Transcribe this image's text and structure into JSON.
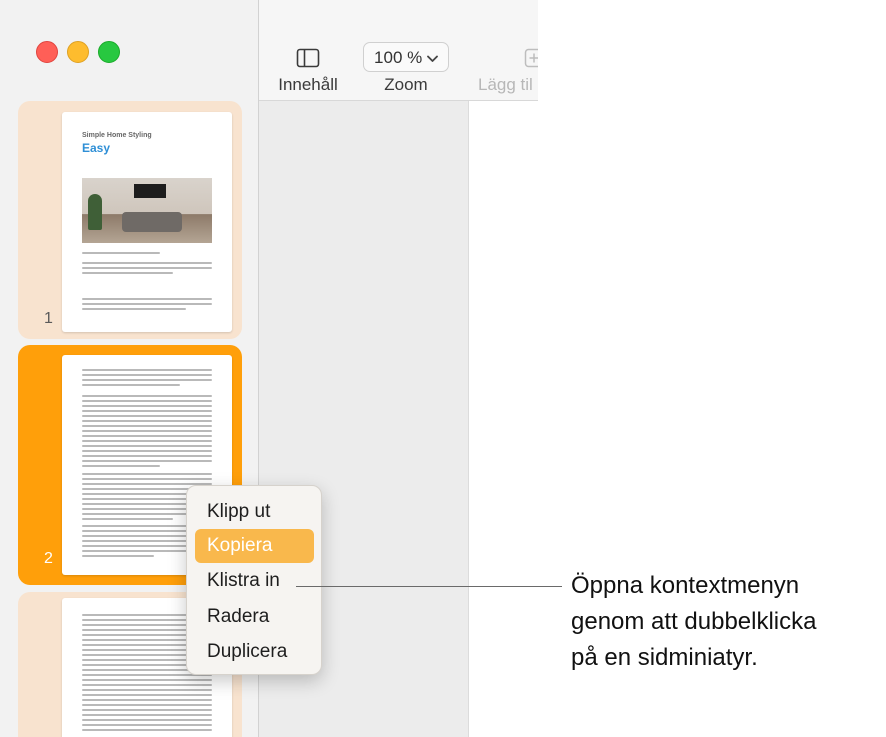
{
  "toolbar": {
    "content_label": "Innehåll",
    "zoom_value": "100 %",
    "zoom_label": "Zoom",
    "add_label": "Lägg til"
  },
  "thumbnails": [
    {
      "page_number": "1",
      "title": "Simple Home Styling",
      "subtitle": "Easy"
    },
    {
      "page_number": "2"
    }
  ],
  "context_menu": {
    "items": [
      "Klipp ut",
      "Kopiera",
      "Klistra in",
      "Radera",
      "Duplicera"
    ],
    "highlighted": "Kopiera"
  },
  "callout": {
    "lines": [
      "Öppna kontextmenyn",
      "genom att dubbelklicka",
      "på en sidminiatyr."
    ]
  },
  "colors": {
    "selected_thumb": "#ff9f0a",
    "unselected_thumb": "#f8e3cf",
    "menu_highlight": "#f9b84c"
  }
}
